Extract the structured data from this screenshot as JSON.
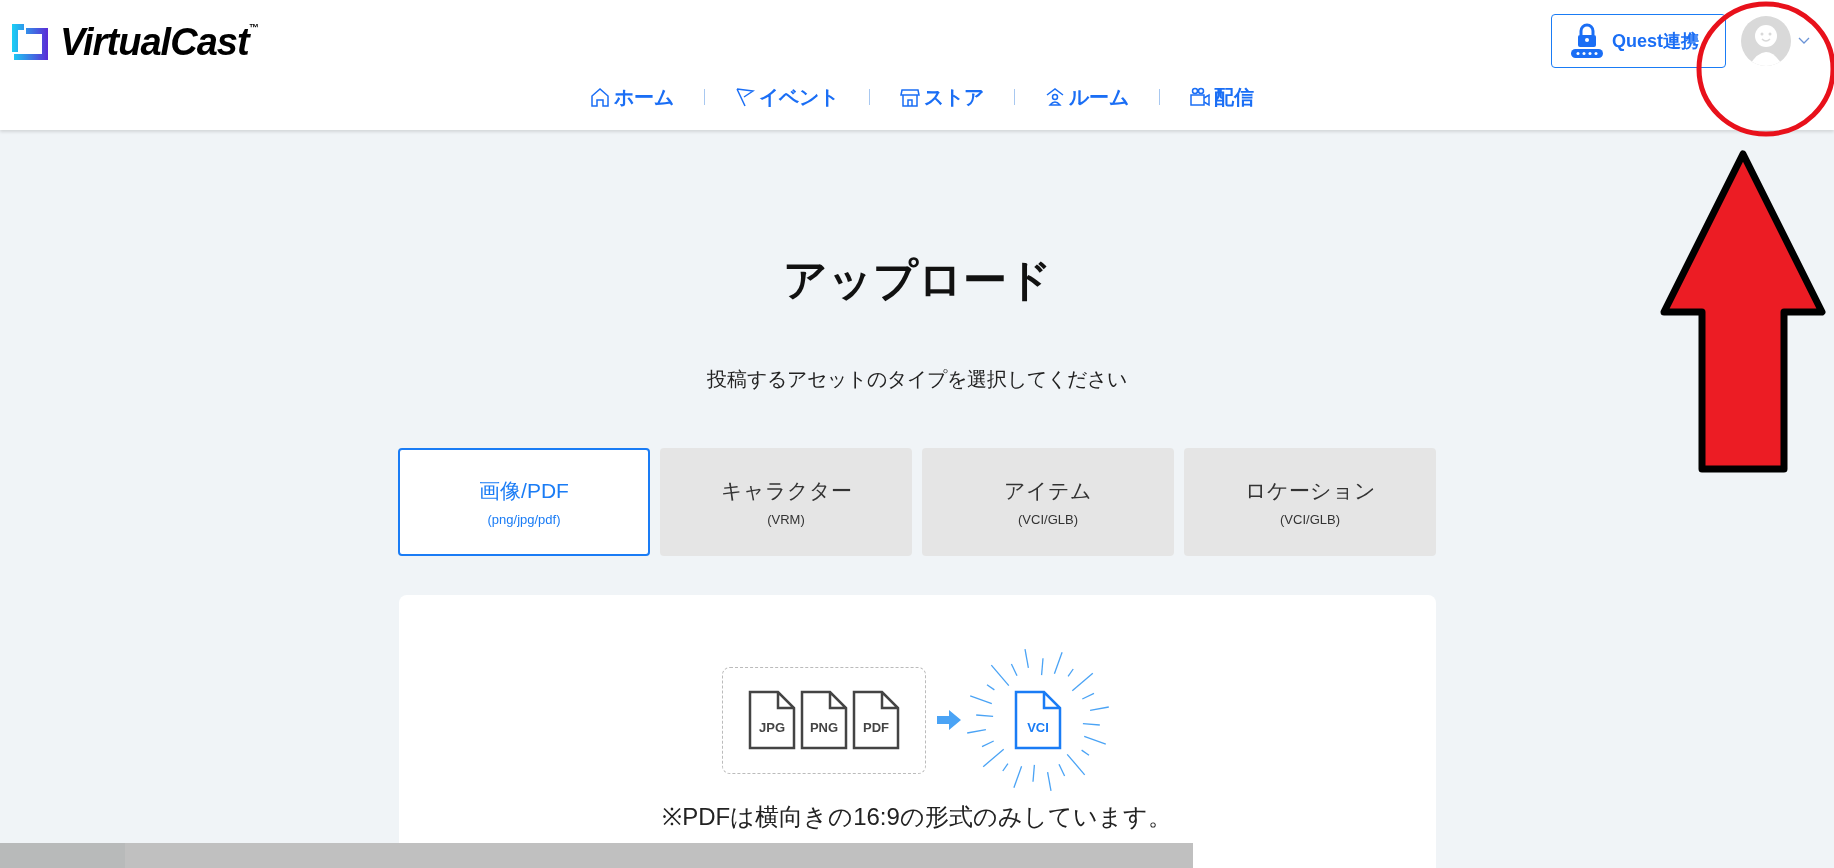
{
  "header": {
    "logo": {
      "name": "VirtualCast",
      "mark": "™"
    },
    "nav": [
      {
        "kind": "home",
        "label": "ホーム"
      },
      {
        "kind": "flag",
        "label": "イベント"
      },
      {
        "kind": "store",
        "label": "ストア"
      },
      {
        "kind": "room",
        "label": "ルーム"
      },
      {
        "kind": "stream",
        "label": "配信"
      }
    ],
    "quest_button": "Quest連携"
  },
  "page": {
    "title": "アップロード",
    "subtitle": "投稿するアセットのタイプを選択してください",
    "asset_types": [
      {
        "label": "画像/PDF",
        "formats": "(png/jpg/pdf)",
        "selected": true
      },
      {
        "label": "キャラクター",
        "formats": "(VRM)",
        "selected": false
      },
      {
        "label": "アイテム",
        "formats": "(VCI/GLB)",
        "selected": false
      },
      {
        "label": "ロケーション",
        "formats": "(VCI/GLB)",
        "selected": false
      }
    ],
    "conversion": {
      "inputs": [
        "JPG",
        "PNG",
        "PDF"
      ],
      "output": "VCI"
    },
    "note": "※PDFは横向きの16:9の形式のみしています。"
  }
}
